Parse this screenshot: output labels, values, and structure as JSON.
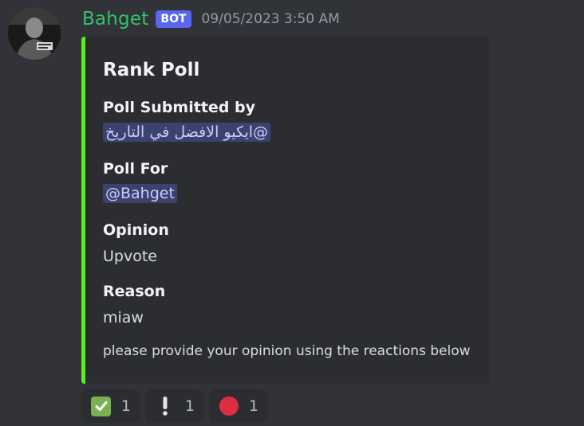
{
  "message": {
    "author": "Bahget",
    "badge": "BOT",
    "timestamp": "09/05/2023 3:50 AM"
  },
  "colors": {
    "author": "#2fc56c",
    "embed_accent": "#5cf01b",
    "bot_badge": "#5865f2",
    "mention_bg": "#3c4270"
  },
  "embed": {
    "title": "Rank Poll",
    "fields": [
      {
        "name": "Poll Submitted by",
        "value": "@ايكيو الافضل في التاريخ",
        "mention": true
      },
      {
        "name": "Poll For",
        "value": "@Bahget",
        "mention": true
      },
      {
        "name": "Opinion",
        "value": "Upvote",
        "mention": false
      },
      {
        "name": "Reason",
        "value": "miaw",
        "mention": false
      }
    ],
    "footer": "please provide your opinion using the reactions below"
  },
  "reactions": [
    {
      "emoji": "white-check-mark",
      "count": "1"
    },
    {
      "emoji": "exclamation",
      "count": "1"
    },
    {
      "emoji": "red-circle",
      "count": "1"
    }
  ]
}
